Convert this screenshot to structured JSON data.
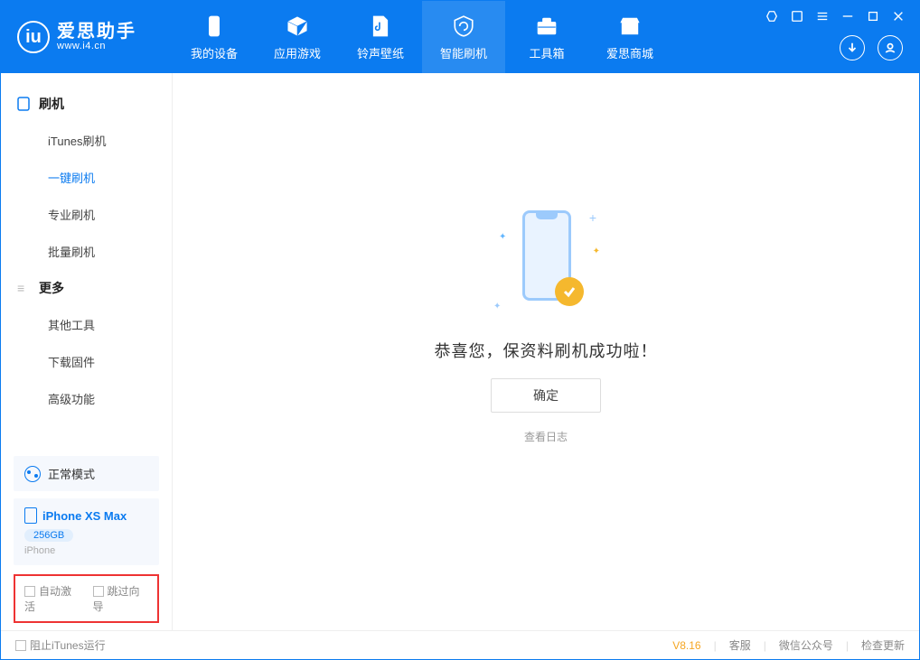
{
  "app": {
    "name": "爱思助手",
    "url": "www.i4.cn"
  },
  "nav": {
    "items": [
      {
        "label": "我的设备"
      },
      {
        "label": "应用游戏"
      },
      {
        "label": "铃声壁纸"
      },
      {
        "label": "智能刷机"
      },
      {
        "label": "工具箱"
      },
      {
        "label": "爱思商城"
      }
    ]
  },
  "sidebar": {
    "group1": {
      "title": "刷机",
      "items": [
        "iTunes刷机",
        "一键刷机",
        "专业刷机",
        "批量刷机"
      ]
    },
    "group2": {
      "title": "更多",
      "items": [
        "其他工具",
        "下载固件",
        "高级功能"
      ]
    },
    "mode": "正常模式",
    "device": {
      "name": "iPhone XS Max",
      "capacity": "256GB",
      "type": "iPhone"
    },
    "checks": {
      "auto_activate": "自动激活",
      "skip_guide": "跳过向导"
    }
  },
  "main": {
    "success": "恭喜您，保资料刷机成功啦！",
    "ok": "确定",
    "loglink": "查看日志"
  },
  "footer": {
    "block_itunes": "阻止iTunes运行",
    "version": "V8.16",
    "links": [
      "客服",
      "微信公众号",
      "检查更新"
    ]
  }
}
